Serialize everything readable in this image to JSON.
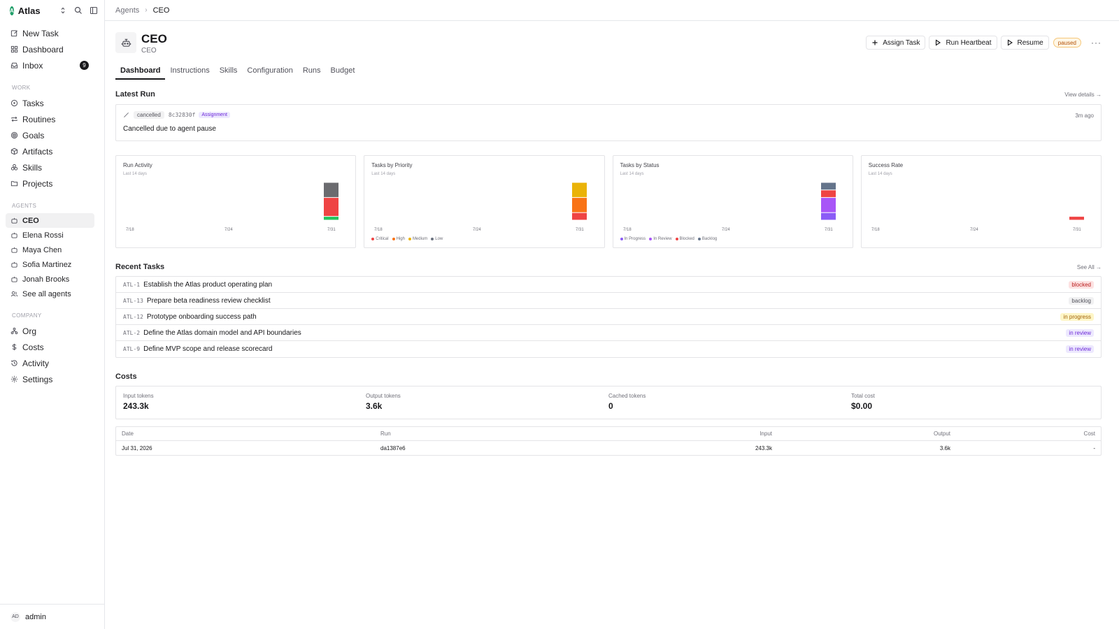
{
  "workspace": {
    "name": "Atlas",
    "logo_letter": "A"
  },
  "sidebar": {
    "primary": [
      {
        "label": "New Task",
        "icon": "edit-icon"
      },
      {
        "label": "Dashboard",
        "icon": "grid-icon"
      },
      {
        "label": "Inbox",
        "icon": "inbox-icon",
        "count": "9"
      }
    ],
    "work_label": "WORK",
    "work": [
      {
        "label": "Tasks",
        "icon": "circle-icon"
      },
      {
        "label": "Routines",
        "icon": "repeat-icon"
      },
      {
        "label": "Goals",
        "icon": "target-icon"
      },
      {
        "label": "Artifacts",
        "icon": "box-icon"
      },
      {
        "label": "Skills",
        "icon": "boxes-icon"
      },
      {
        "label": "Projects",
        "icon": "folder-icon"
      }
    ],
    "agents_label": "AGENTS",
    "agents": [
      {
        "label": "CEO",
        "active": true
      },
      {
        "label": "Elena Rossi"
      },
      {
        "label": "Maya Chen"
      },
      {
        "label": "Sofia Martinez"
      },
      {
        "label": "Jonah Brooks"
      },
      {
        "label": "See all agents"
      }
    ],
    "company_label": "COMPANY",
    "company": [
      {
        "label": "Org",
        "icon": "org-icon"
      },
      {
        "label": "Costs",
        "icon": "dollar-icon"
      },
      {
        "label": "Activity",
        "icon": "history-icon"
      },
      {
        "label": "Settings",
        "icon": "gear-icon"
      }
    ],
    "user": {
      "initials": "AD",
      "name": "admin"
    }
  },
  "breadcrumb": {
    "parent": "Agents",
    "current": "CEO"
  },
  "agent": {
    "name": "CEO",
    "role": "CEO",
    "status": "paused"
  },
  "actions": {
    "assign": "Assign Task",
    "heartbeat": "Run Heartbeat",
    "resume": "Resume",
    "more": "···"
  },
  "tabs": [
    "Dashboard",
    "Instructions",
    "Skills",
    "Configuration",
    "Runs",
    "Budget"
  ],
  "latest_run": {
    "section_title": "Latest Run",
    "view_details": "View details →",
    "status": "cancelled",
    "hash": "8c32830f",
    "tag": "Assignment",
    "time": "3m ago",
    "message": "Cancelled due to agent pause"
  },
  "charts_text": {
    "run_activity": {
      "title": "Run Activity",
      "subtitle": "Last 14 days"
    },
    "priority": {
      "title": "Tasks by Priority",
      "subtitle": "Last 14 days"
    },
    "status": {
      "title": "Tasks by Status",
      "subtitle": "Last 14 days"
    },
    "success": {
      "title": "Success Rate",
      "subtitle": "Last 14 days"
    }
  },
  "chart_data": [
    {
      "type": "bar",
      "title": "Run Activity",
      "subtitle": "Last 14 days",
      "stacked": true,
      "tick_labels": [
        "7/18",
        "7/24",
        "7/31"
      ],
      "categories": [
        "7/18",
        "7/19",
        "7/20",
        "7/21",
        "7/22",
        "7/23",
        "7/24",
        "7/25",
        "7/26",
        "7/27",
        "7/28",
        "7/29",
        "7/30",
        "7/31"
      ],
      "series": [
        {
          "color": "#22c55e",
          "values": [
            0,
            0,
            0,
            0,
            0,
            0,
            0,
            0,
            0,
            0,
            0,
            0,
            0,
            1
          ]
        },
        {
          "color": "#ef4444",
          "values": [
            0,
            0,
            0,
            0,
            0,
            0,
            0,
            0,
            0,
            0,
            0,
            0,
            0,
            5
          ]
        },
        {
          "color": "#6b6b6f",
          "values": [
            0,
            0,
            0,
            0,
            0,
            0,
            0,
            0,
            0,
            0,
            0,
            0,
            0,
            4
          ]
        }
      ]
    },
    {
      "type": "bar",
      "title": "Tasks by Priority",
      "subtitle": "Last 14 days",
      "stacked": true,
      "tick_labels": [
        "7/18",
        "7/24",
        "7/31"
      ],
      "categories": [
        "7/18",
        "7/19",
        "7/20",
        "7/21",
        "7/22",
        "7/23",
        "7/24",
        "7/25",
        "7/26",
        "7/27",
        "7/28",
        "7/29",
        "7/30",
        "7/31"
      ],
      "series": [
        {
          "name": "Critical",
          "color": "#ef4444",
          "values": [
            0,
            0,
            0,
            0,
            0,
            0,
            0,
            0,
            0,
            0,
            0,
            0,
            0,
            2
          ]
        },
        {
          "name": "High",
          "color": "#f97316",
          "values": [
            0,
            0,
            0,
            0,
            0,
            0,
            0,
            0,
            0,
            0,
            0,
            0,
            0,
            4
          ]
        },
        {
          "name": "Medium",
          "color": "#eab308",
          "values": [
            0,
            0,
            0,
            0,
            0,
            0,
            0,
            0,
            0,
            0,
            0,
            0,
            0,
            4
          ]
        },
        {
          "name": "Low",
          "color": "#6b7280",
          "values": [
            0,
            0,
            0,
            0,
            0,
            0,
            0,
            0,
            0,
            0,
            0,
            0,
            0,
            0
          ]
        }
      ]
    },
    {
      "type": "bar",
      "title": "Tasks by Status",
      "subtitle": "Last 14 days",
      "stacked": true,
      "tick_labels": [
        "7/18",
        "7/24",
        "7/31"
      ],
      "categories": [
        "7/18",
        "7/19",
        "7/20",
        "7/21",
        "7/22",
        "7/23",
        "7/24",
        "7/25",
        "7/26",
        "7/27",
        "7/28",
        "7/29",
        "7/30",
        "7/31"
      ],
      "series": [
        {
          "name": "In Progress",
          "color": "#8b5cf6",
          "values": [
            0,
            0,
            0,
            0,
            0,
            0,
            0,
            0,
            0,
            0,
            0,
            0,
            0,
            2
          ]
        },
        {
          "name": "In Review",
          "color": "#a855f7",
          "values": [
            0,
            0,
            0,
            0,
            0,
            0,
            0,
            0,
            0,
            0,
            0,
            0,
            0,
            4
          ]
        },
        {
          "name": "Blocked",
          "color": "#ef4444",
          "values": [
            0,
            0,
            0,
            0,
            0,
            0,
            0,
            0,
            0,
            0,
            0,
            0,
            0,
            2
          ]
        },
        {
          "name": "Backlog",
          "color": "#64748b",
          "values": [
            0,
            0,
            0,
            0,
            0,
            0,
            0,
            0,
            0,
            0,
            0,
            0,
            0,
            2
          ]
        }
      ]
    },
    {
      "type": "bar",
      "title": "Success Rate",
      "subtitle": "Last 14 days",
      "tick_labels": [
        "7/18",
        "7/24",
        "7/31"
      ],
      "categories": [
        "7/18",
        "7/19",
        "7/20",
        "7/21",
        "7/22",
        "7/23",
        "7/24",
        "7/25",
        "7/26",
        "7/27",
        "7/28",
        "7/29",
        "7/30",
        "7/31"
      ],
      "ylim": [
        0,
        100
      ],
      "series": [
        {
          "color": "#ef4444",
          "values": [
            0,
            0,
            0,
            0,
            0,
            0,
            0,
            0,
            0,
            0,
            0,
            0,
            0,
            10
          ]
        }
      ]
    }
  ],
  "recent_tasks": {
    "section_title": "Recent Tasks",
    "see_all": "See All →",
    "items": [
      {
        "id": "ATL-1",
        "title": "Establish the Atlas product operating plan",
        "status": "blocked",
        "fg": "#b91c1c",
        "bg": "#fde2e2"
      },
      {
        "id": "ATL-13",
        "title": "Prepare beta readiness review checklist",
        "status": "backlog",
        "fg": "#52525b",
        "bg": "#f1f1f2"
      },
      {
        "id": "ATL-12",
        "title": "Prototype onboarding success path",
        "status": "in progress",
        "fg": "#a16207",
        "bg": "#fef6c7"
      },
      {
        "id": "ATL-2",
        "title": "Define the Atlas domain model and API boundaries",
        "status": "in review",
        "fg": "#6d28d9",
        "bg": "#ede9fe"
      },
      {
        "id": "ATL-9",
        "title": "Define MVP scope and release scorecard",
        "status": "in review",
        "fg": "#6d28d9",
        "bg": "#ede9fe"
      }
    ]
  },
  "costs": {
    "section_title": "Costs",
    "summary": [
      {
        "label": "Input tokens",
        "value": "243.3k"
      },
      {
        "label": "Output tokens",
        "value": "3.6k"
      },
      {
        "label": "Cached tokens",
        "value": "0"
      },
      {
        "label": "Total cost",
        "value": "$0.00"
      }
    ],
    "table": {
      "headers": {
        "date": "Date",
        "run": "Run",
        "input": "Input",
        "output": "Output",
        "cost": "Cost"
      },
      "rows": [
        {
          "date": "Jul 31, 2026",
          "run": "da1387e6",
          "input": "243.3k",
          "output": "3.6k",
          "cost": "-"
        }
      ]
    }
  }
}
